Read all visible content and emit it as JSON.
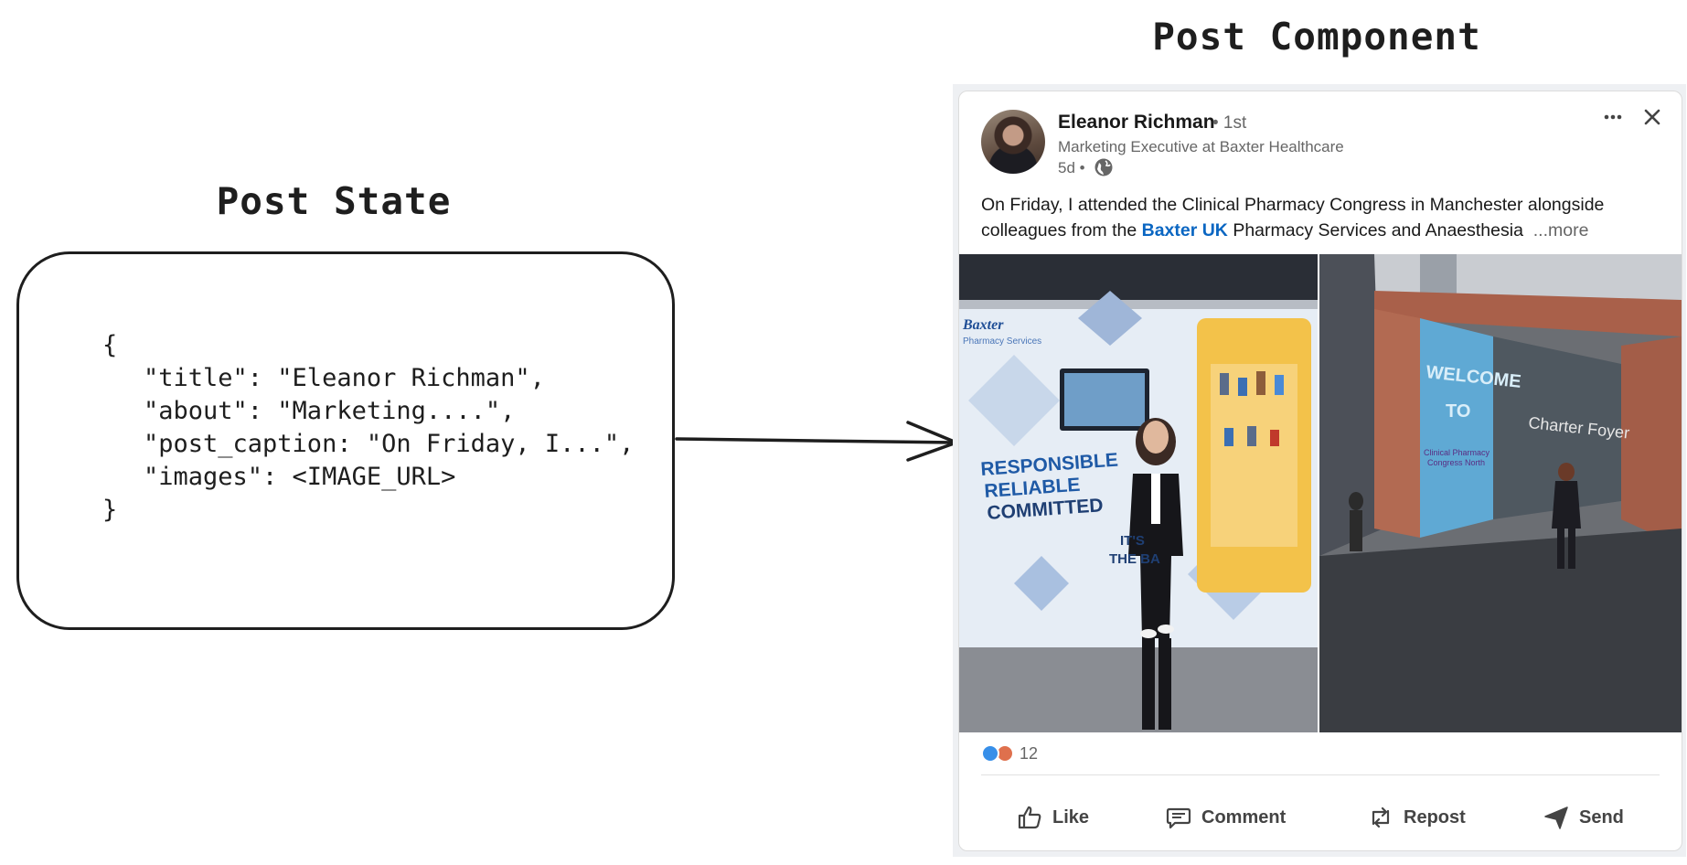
{
  "post_state": {
    "title": "Post State",
    "code_lines": [
      "{",
      "\"title\": \"Eleanor Richman\",",
      "\"about\": \"Marketing....\",",
      "\"post_caption: \"On Friday, I...\",",
      "\"images\": <IMAGE_URL>",
      "}"
    ]
  },
  "post_component": {
    "title": "Post Component",
    "author": {
      "name": "Eleanor Richman",
      "degree": "• 1st",
      "about": "Marketing Executive at Baxter Healthcare",
      "age": "5d •"
    },
    "caption": {
      "text_before": "On Friday, I attended the Clinical Pharmacy Congress in Manchester alongside colleagues from the ",
      "link": "Baxter UK",
      "text_after": " Pharmacy Services and Anaesthesia",
      "more": "...more"
    },
    "images": {
      "left": {
        "brand": "Baxter",
        "brand_sub": "Pharmacy Services",
        "slogan": [
          "RESPONSIBLE",
          "RELIABLE",
          "COMMITTED"
        ],
        "tag": [
          "IT'S",
          "THE BA"
        ]
      },
      "right": {
        "banner": [
          "WELCOME",
          "TO"
        ],
        "sign": "Charter Foyer",
        "logo": [
          "Clinical Pharmacy",
          "Congress North"
        ]
      }
    },
    "reactions": {
      "count": "12",
      "icons": [
        "like-icon",
        "love-icon"
      ]
    },
    "actions": [
      {
        "label": "Like",
        "icon": "thumbs-up-icon"
      },
      {
        "label": "Comment",
        "icon": "comment-icon"
      },
      {
        "label": "Repost",
        "icon": "repost-icon"
      },
      {
        "label": "Send",
        "icon": "send-icon"
      }
    ],
    "colors": {
      "link": "#0a66c2",
      "text": "#191919",
      "muted": "#666666"
    }
  }
}
